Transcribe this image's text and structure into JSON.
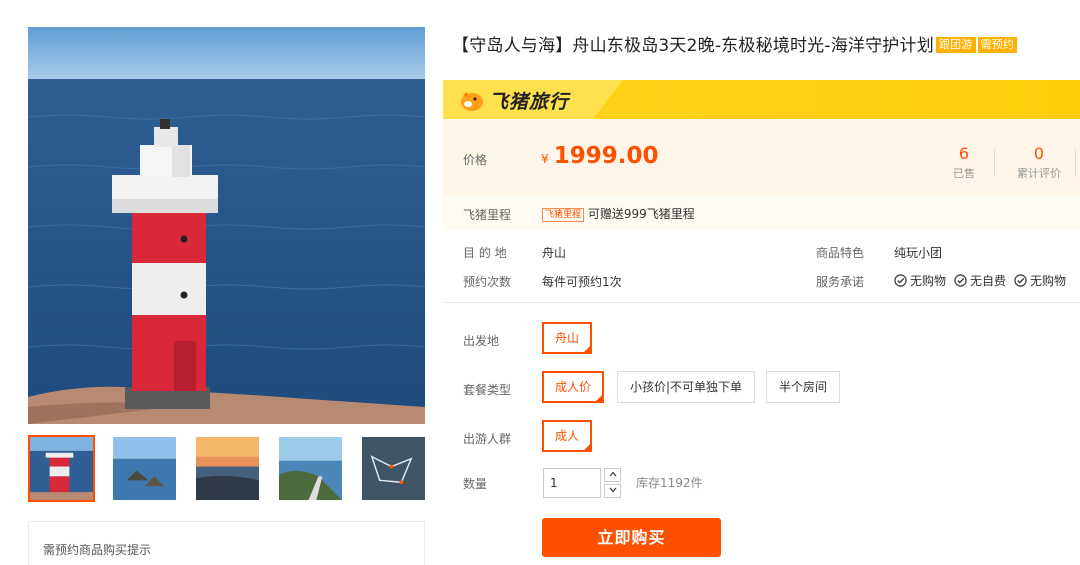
{
  "product": {
    "title": "【守岛人与海】舟山东极岛3天2晚-东极秘境时光-海洋守护计划",
    "badges": [
      "跟团游",
      "需预约"
    ]
  },
  "gallery": {
    "main_image": "lighthouse-sea",
    "thumbnails": [
      "lighthouse-sea",
      "island-rocks-sea",
      "sunset-coast",
      "coastal-village-path",
      "route-map"
    ],
    "active_index": 0,
    "tip_title": "需预约商品购买提示"
  },
  "brand": {
    "logo_text": "飞猪旅行",
    "accent": "#ffd21a"
  },
  "price": {
    "label": "价格",
    "currency": "¥",
    "value": "1999.00",
    "sold_count": "6",
    "sold_label": "已售",
    "review_count": "0",
    "review_label": "累计评价"
  },
  "miles": {
    "label": "飞猪里程",
    "tag": "飞猪里程",
    "text": "可赠送999飞猪里程"
  },
  "info": {
    "destination_label": "目 的 地",
    "destination": "舟山",
    "booking_label": "预约次数",
    "booking": "每件可预约1次",
    "feature_label": "商品特色",
    "feature": "纯玩小团",
    "service_label": "服务承诺",
    "promises": [
      "无购物",
      "无自费",
      "无购物"
    ]
  },
  "options": {
    "departure_label": "出发地",
    "departure": [
      "舟山"
    ],
    "package_label": "套餐类型",
    "packages": [
      "成人价",
      "小孩价|不可单独下单",
      "半个房间"
    ],
    "traveler_label": "出游人群",
    "travelers": [
      "成人"
    ]
  },
  "quantity": {
    "label": "数量",
    "value": "1",
    "stock_text": "库存1192件"
  },
  "buy_button": "立即购买",
  "colors": {
    "primary": "#ff5000",
    "brand_yellow": "#ffd21a",
    "badge": "#ffb000"
  }
}
